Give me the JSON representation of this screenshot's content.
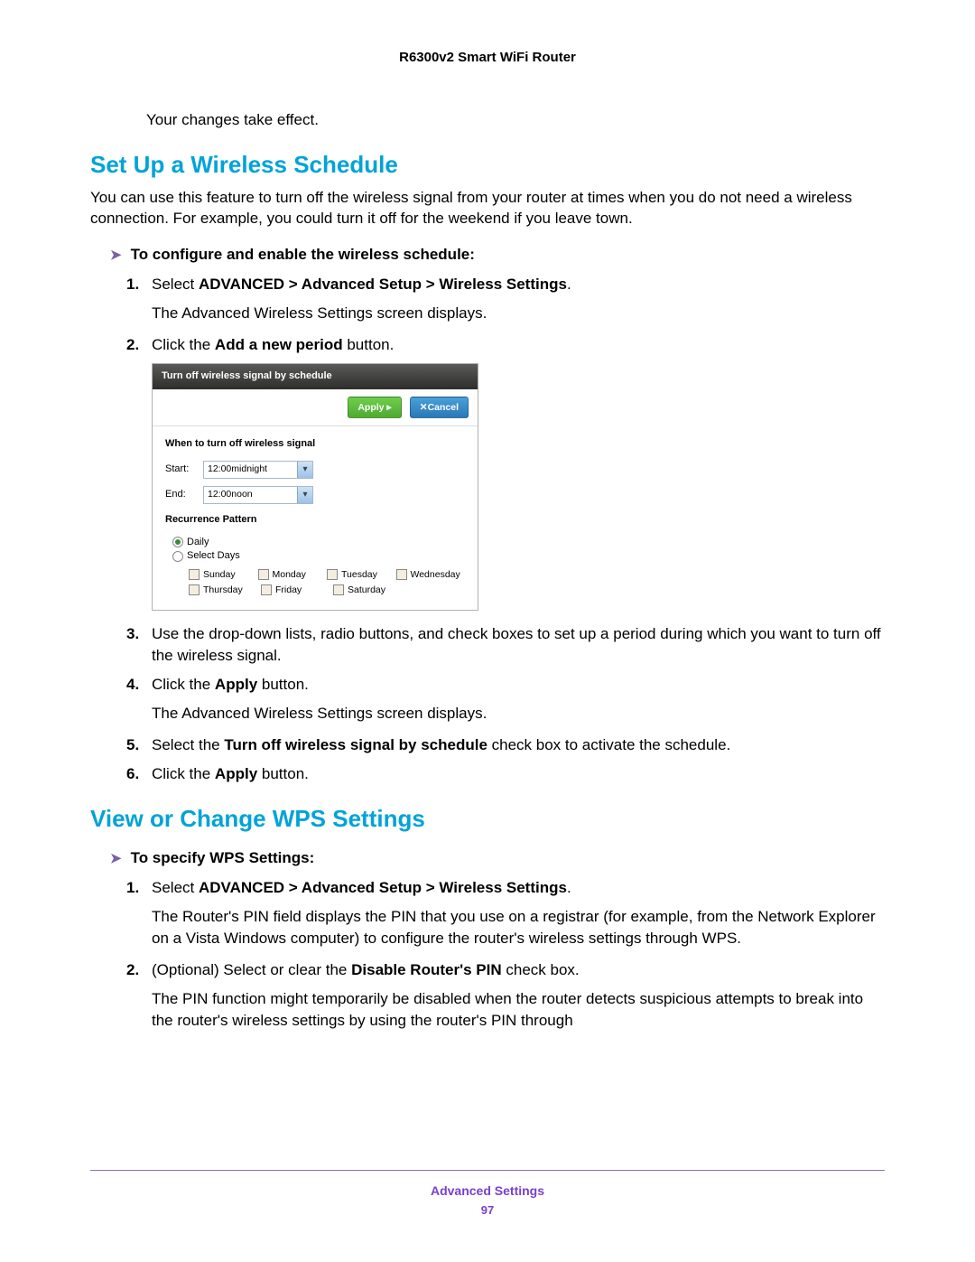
{
  "header": {
    "title": "R6300v2 Smart WiFi Router"
  },
  "intro": {
    "lead_sentence": "Your changes take effect."
  },
  "section1": {
    "heading": "Set Up a Wireless Schedule",
    "paragraph": "You can use this feature to turn off the wireless signal from your router at times when you do not need a wireless connection. For example, you could turn it off for the weekend if you leave town.",
    "task": "To configure and enable the wireless schedule:",
    "steps": {
      "s1_pre": "Select ",
      "s1_bold": "ADVANCED > Advanced Setup > Wireless Settings",
      "s1_post": ".",
      "s1_result": "The Advanced Wireless Settings screen displays.",
      "s2_pre": "Click the ",
      "s2_bold": "Add a new period",
      "s2_post": " button.",
      "s3": "Use the drop-down lists, radio buttons, and check boxes to set up a period during which you want to turn off the wireless signal.",
      "s4_pre": "Click the ",
      "s4_bold": "Apply",
      "s4_post": " button.",
      "s4_result": "The Advanced Wireless Settings screen displays.",
      "s5_pre": "Select the ",
      "s5_bold": "Turn off wireless signal by schedule",
      "s5_post": " check box to activate the schedule.",
      "s6_pre": "Click the ",
      "s6_bold": "Apply",
      "s6_post": " button."
    }
  },
  "dialog": {
    "title": "Turn off wireless signal by schedule",
    "apply_label": "Apply ▸",
    "cancel_label": "✕Cancel",
    "when_label": "When to turn off wireless signal",
    "start_label": "Start:",
    "start_value": "12:00midnight",
    "end_label": "End:",
    "end_value": "12:00noon",
    "recurrence_label": "Recurrence Pattern",
    "opt_daily": "Daily",
    "opt_select_days": "Select Days",
    "days": {
      "sun": "Sunday",
      "mon": "Monday",
      "tue": "Tuesday",
      "wed": "Wednesday",
      "thu": "Thursday",
      "fri": "Friday",
      "sat": "Saturday"
    }
  },
  "section2": {
    "heading": "View or Change WPS Settings",
    "task": "To specify WPS Settings:",
    "steps": {
      "s1_pre": "Select ",
      "s1_bold": "ADVANCED > Advanced Setup > Wireless Settings",
      "s1_post": ".",
      "s1_result": "The Router's PIN field displays the PIN that you use on a registrar (for example, from the Network Explorer on a Vista Windows computer) to configure the router's wireless settings through WPS.",
      "s2_pre": "(Optional) Select or clear the ",
      "s2_bold": "Disable Router's PIN",
      "s2_post": " check box.",
      "s2_result": "The PIN function might temporarily be disabled when the router detects suspicious attempts to break into the router's wireless settings by using the router's PIN through"
    }
  },
  "footer": {
    "section": "Advanced Settings",
    "page": "97"
  }
}
